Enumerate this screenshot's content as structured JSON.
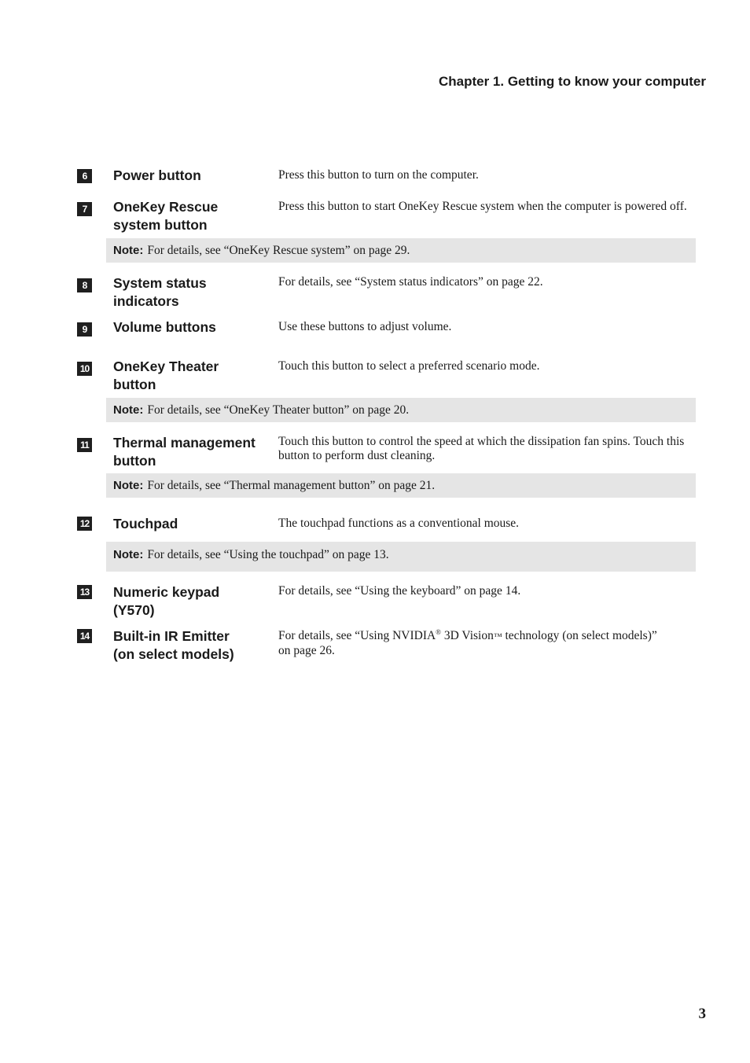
{
  "header": {
    "chapter_title": "Chapter 1. Getting to know your computer"
  },
  "page_number": "3",
  "items": [
    {
      "number": "6",
      "term": "Power button",
      "description": "Press this button to turn on the computer."
    },
    {
      "number": "7",
      "term": "OneKey Rescue system button",
      "description": "Press this button to start OneKey Rescue system when the computer is powered off."
    },
    {
      "number": "8",
      "term": "System status indicators",
      "description": "For details, see “System status indicators” on page 22."
    },
    {
      "number": "9",
      "term": "Volume buttons",
      "description": "Use these buttons to adjust volume."
    },
    {
      "number": "10",
      "term": "OneKey Theater button",
      "description": "Touch this button to select a preferred scenario mode."
    },
    {
      "number": "11",
      "term": "Thermal management button",
      "description": "Touch this button to control the speed at which the dissipation fan spins. Touch this button to perform dust cleaning."
    },
    {
      "number": "12",
      "term": "Touchpad",
      "description": "The touchpad functions as a conventional mouse."
    },
    {
      "number": "13",
      "term": "Numeric keypad (Y570)",
      "description": "For details, see “Using the keyboard” on page 14."
    },
    {
      "number": "14",
      "term": "Built-in IR Emitter (on select models)",
      "description_parts": {
        "before": "For details, see “Using NVIDIA",
        "reg": "®",
        "middle": " 3D Vision",
        "tm": "™",
        "after": " technology (on select models)” on page 26."
      }
    }
  ],
  "notes": [
    {
      "label": "Note:",
      "text": "For details, see “OneKey Rescue system” on page 29."
    },
    {
      "label": "Note:",
      "text": "For details, see “OneKey Theater button” on page 20."
    },
    {
      "label": "Note:",
      "text": "For details, see “Thermal management button” on page 21."
    },
    {
      "label": "Note:",
      "text": "For details, see “Using the touchpad” on page 13."
    }
  ]
}
